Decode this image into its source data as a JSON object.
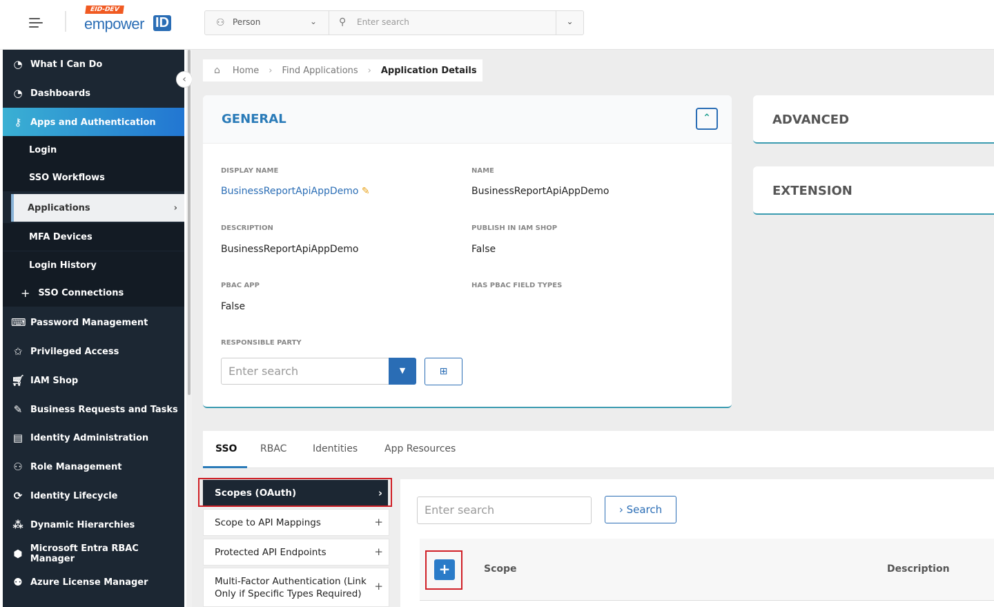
{
  "app": {
    "logo_tag": "EID-DEV",
    "logo_text": "empower",
    "logo_id": "ID",
    "search_scope": "Person",
    "search_placeholder": "Enter search"
  },
  "icons": {
    "menu": "hamburger-icon",
    "person": "person-icon",
    "search": "search-icon",
    "chevron_down": "chevron-down-icon",
    "home": "home-icon",
    "edit": "pencil-icon"
  },
  "sidebar": {
    "items": [
      {
        "label": "What I Can Do",
        "icon": "gauge-icon"
      },
      {
        "label": "Dashboards",
        "icon": "gauge-icon"
      },
      {
        "label": "Apps and Authentication",
        "icon": "user-key-icon",
        "active": true
      },
      {
        "label": "Password Management",
        "icon": "password-icon"
      },
      {
        "label": "Privileged Access",
        "icon": "star-icon"
      },
      {
        "label": "IAM Shop",
        "icon": "cart-icon"
      },
      {
        "label": "Business Requests and Tasks",
        "icon": "edit-doc-icon"
      },
      {
        "label": "Identity Administration",
        "icon": "id-card-icon"
      },
      {
        "label": "Role Management",
        "icon": "user-settings-icon"
      },
      {
        "label": "Identity Lifecycle",
        "icon": "lifecycle-icon"
      },
      {
        "label": "Dynamic Hierarchies",
        "icon": "hierarchy-icon"
      },
      {
        "label": "Microsoft Entra RBAC Manager",
        "icon": "cubes-icon"
      },
      {
        "label": "Azure License Manager",
        "icon": "users-group-icon"
      }
    ],
    "subitems": [
      {
        "label": "Login"
      },
      {
        "label": "SSO Workflows"
      },
      {
        "label": "Applications",
        "selected": true
      },
      {
        "label": "MFA Devices"
      },
      {
        "label": "Login History"
      },
      {
        "label": "SSO Connections",
        "prefix": "+"
      }
    ]
  },
  "breadcrumb": {
    "items": [
      "Home",
      "Find Applications",
      "Application Details"
    ]
  },
  "general": {
    "title": "GENERAL",
    "fields": {
      "display_name_label": "DISPLAY NAME",
      "display_name": "BusinessReportApiAppDemo",
      "name_label": "NAME",
      "name": "BusinessReportApiAppDemo",
      "description_label": "DESCRIPTION",
      "description": "BusinessReportApiAppDemo",
      "publish_label": "PUBLISH IN IAM SHOP",
      "publish": "False",
      "pbac_label": "PBAC APP",
      "pbac": "False",
      "has_pbac_label": "HAS PBAC FIELD TYPES",
      "responsible_label": "RESPONSIBLE PARTY",
      "responsible_placeholder": "Enter search"
    }
  },
  "side_cards": [
    "ADVANCED",
    "EXTENSION"
  ],
  "tabs": [
    "SSO",
    "RBAC",
    "Identities",
    "App Resources"
  ],
  "sso_menu": [
    {
      "label": "Scopes (OAuth)",
      "active": true,
      "marker": "›"
    },
    {
      "label": "Scope to API Mappings",
      "marker": "+"
    },
    {
      "label": "Protected API Endpoints",
      "marker": "+"
    },
    {
      "label": "Multi-Factor Authentication (Link Only if Specific Types Required)",
      "marker": "+"
    }
  ],
  "scopes": {
    "search_placeholder": "Enter search",
    "search_button": "Search",
    "columns": [
      "Scope",
      "Description"
    ]
  }
}
